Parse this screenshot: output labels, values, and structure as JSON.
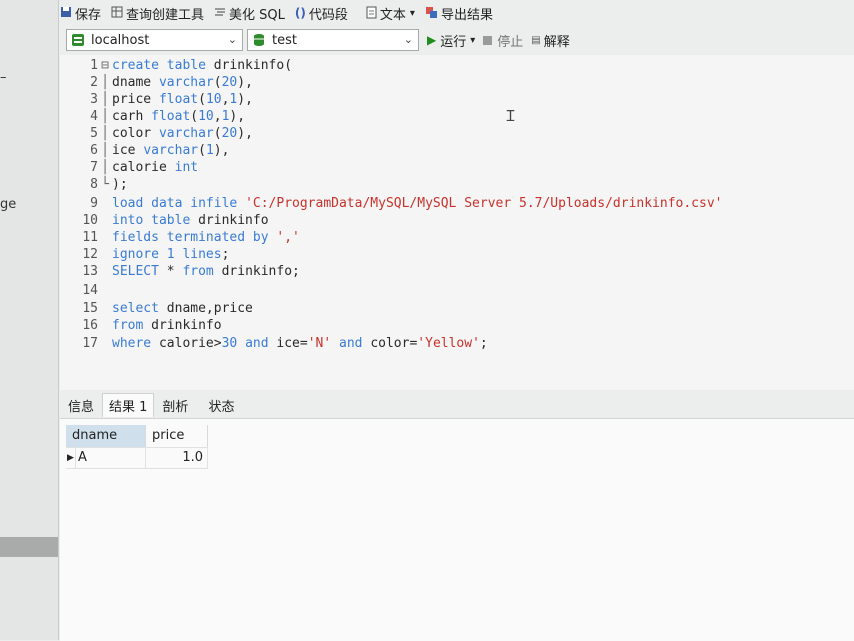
{
  "toolbar": {
    "save": "保存",
    "query_builder": "查询创建工具",
    "beautify_sql": "美化 SQL",
    "code_snippet": "代码段",
    "text": "文本",
    "export_results": "导出结果"
  },
  "connection": {
    "server": "localhost",
    "database": "test"
  },
  "run_controls": {
    "run": "运行",
    "stop": "停止",
    "explain": "解释"
  },
  "left_panel_fragments": [
    "ge"
  ],
  "editor": {
    "lines": [
      "create table drinkinfo(",
      "dname varchar(20),",
      "price float(10,1),",
      "carh float(10,1),",
      "color varchar(20),",
      "ice varchar(1),",
      "calorie int",
      ");",
      "load data infile 'C:/ProgramData/MySQL/MySQL Server 5.7/Uploads/drinkinfo.csv'",
      "into table drinkinfo",
      "fields terminated by ','",
      "ignore 1 lines;",
      "SELECT * from drinkinfo;",
      "",
      "select dname,price",
      "from drinkinfo",
      "where calorie>30 and ice='N' and color='Yellow';"
    ]
  },
  "result_tabs": [
    "信息",
    "结果 1",
    "剖析",
    "状态"
  ],
  "active_result_tab": "结果 1",
  "results": {
    "columns": [
      "dname",
      "price"
    ],
    "rows": [
      [
        "A",
        "1.0"
      ]
    ]
  },
  "colors": {
    "keyword": "#3a7bd5",
    "string": "#c8322c",
    "run_icon": "#1e8c1e",
    "db_icon": "#2e8b2e"
  }
}
